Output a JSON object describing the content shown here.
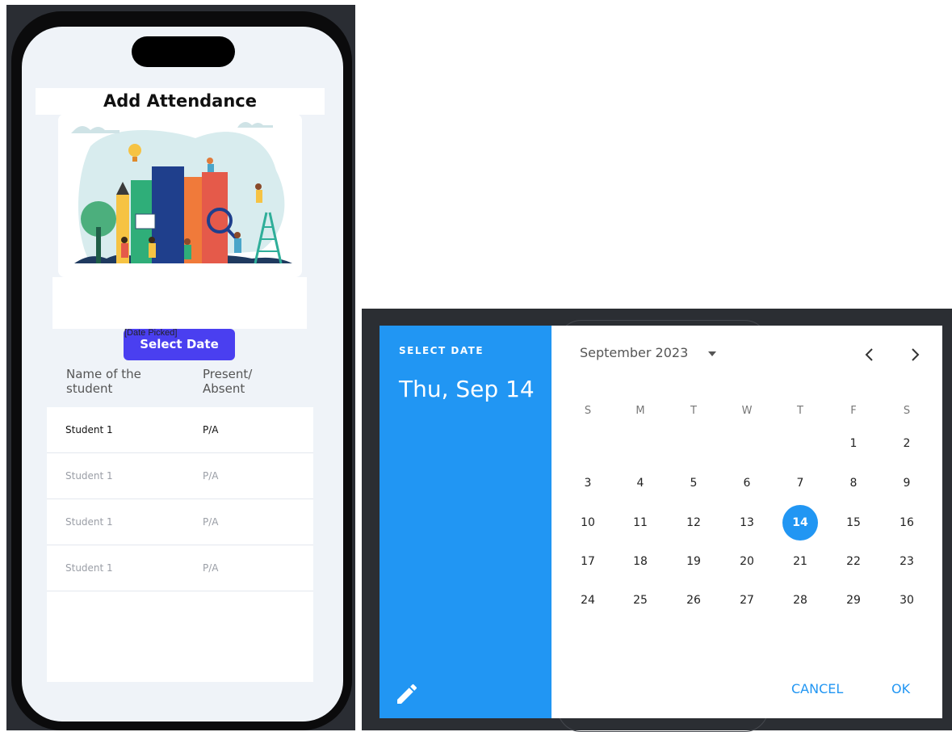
{
  "app": {
    "title": "Add Attendance",
    "date_picked_label": "[Date Picked]",
    "select_date_button": "Select Date",
    "columns": {
      "name": "Name of the student",
      "status": "Present/ Absent"
    },
    "rows": [
      {
        "name": "Student 1",
        "status": "P/A",
        "active": true
      },
      {
        "name": "Student 1",
        "status": "P/A",
        "active": false
      },
      {
        "name": "Student 1",
        "status": "P/A",
        "active": false
      },
      {
        "name": "Student 1",
        "status": "P/A",
        "active": false
      }
    ]
  },
  "date_picker": {
    "header_label": "SELECT DATE",
    "header_date": "Thu, Sep 14",
    "month_label": "September 2023",
    "weekdays": [
      "S",
      "M",
      "T",
      "W",
      "T",
      "F",
      "S"
    ],
    "first_weekday_index": 5,
    "days_in_month": 30,
    "selected_day": 14,
    "cancel_label": "CANCEL",
    "ok_label": "OK",
    "accent_color": "#2196f3",
    "icons": {
      "edit": "pencil-icon",
      "month_dropdown": "caret-down-icon",
      "prev": "chevron-left-icon",
      "next": "chevron-right-icon"
    }
  }
}
